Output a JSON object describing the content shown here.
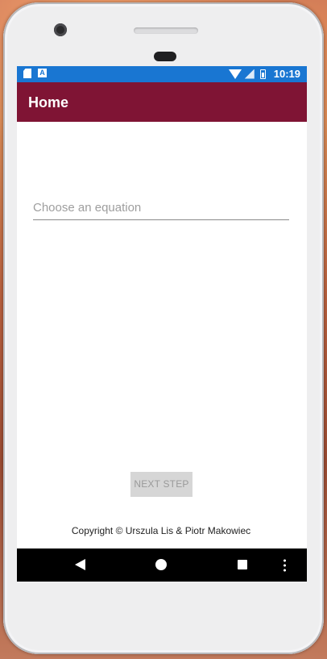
{
  "status_bar": {
    "time": "10:19",
    "left_icons": [
      "sd-card-icon",
      "a-notification-icon"
    ],
    "right_icons": [
      "wifi-icon",
      "signal-icon",
      "battery-icon"
    ],
    "color": "#1976d2"
  },
  "app_bar": {
    "title": "Home",
    "color": "#7f1434"
  },
  "equation_picker": {
    "placeholder": "Choose an equation"
  },
  "next_step_button": {
    "label": "NEXT STEP",
    "enabled": false
  },
  "footer": {
    "copyright": "Copyright © Urszula Lis & Piotr Makowiec"
  },
  "nav_bar": {
    "buttons": [
      "back-icon",
      "home-icon",
      "recent-apps-icon",
      "more-options-icon"
    ]
  }
}
